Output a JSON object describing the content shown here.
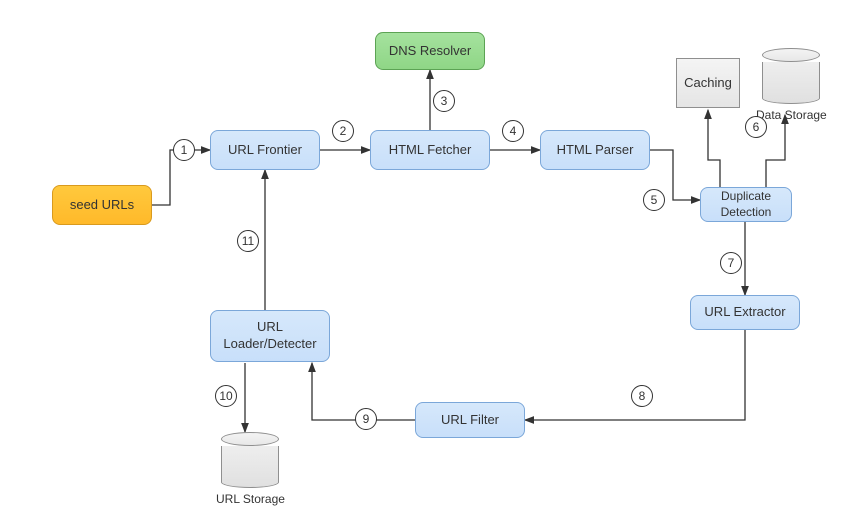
{
  "nodes": {
    "seed_urls": "seed URLs",
    "url_frontier": "URL Frontier",
    "html_fetcher": "HTML Fetcher",
    "dns_resolver": "DNS Resolver",
    "html_parser": "HTML Parser",
    "caching": "Caching",
    "data_storage": "Data\nStorage",
    "duplicate_detection": "Duplicate\nDetection",
    "url_extractor": "URL Extractor",
    "url_filter": "URL Filter",
    "url_loader_detecter": "URL\nLoader/Detecter",
    "url_storage": "URL\nStorage"
  },
  "steps": {
    "1": "1",
    "2": "2",
    "3": "3",
    "4": "4",
    "5": "5",
    "6": "6",
    "7": "7",
    "8": "8",
    "9": "9",
    "10": "10",
    "11": "11"
  }
}
